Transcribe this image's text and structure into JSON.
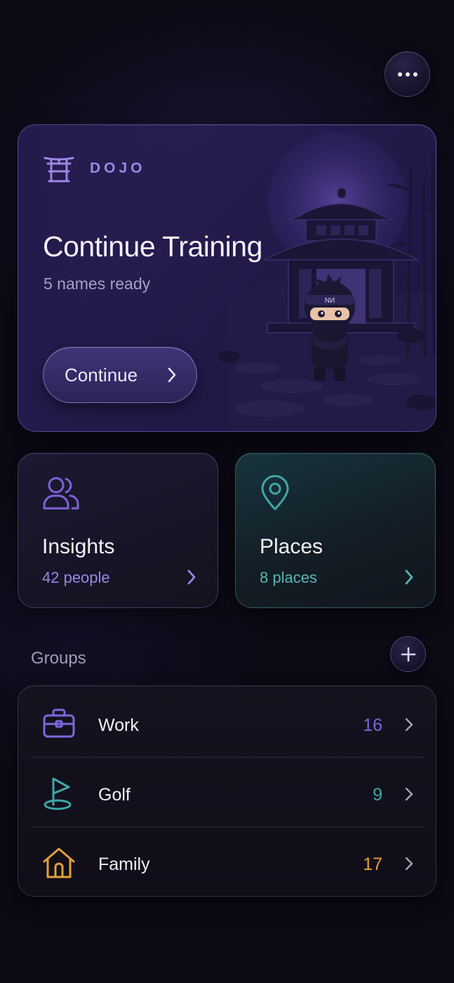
{
  "header": {
    "more_icon": "more-horizontal-icon"
  },
  "hero": {
    "brand_icon": "torii-gate-icon",
    "brand_label": "DOJO",
    "title": "Continue Training",
    "subtitle": "5 names ready",
    "button_label": "Continue",
    "illustration_badge": "NИ"
  },
  "tiles": [
    {
      "title": "Insights",
      "subtitle": "42 people",
      "icon": "people-icon",
      "accent": "#7c63d8"
    },
    {
      "title": "Places",
      "subtitle": "8 places",
      "icon": "map-pin-icon",
      "accent": "#3fa8a6"
    }
  ],
  "groups": {
    "title": "Groups",
    "add_icon": "plus-icon",
    "items": [
      {
        "name": "Work",
        "count": "16",
        "icon": "briefcase-icon",
        "color": "#7d67db"
      },
      {
        "name": "Golf",
        "count": "9",
        "icon": "golf-flag-icon",
        "color": "#3fa8a6"
      },
      {
        "name": "Family",
        "count": "17",
        "icon": "home-icon",
        "color": "#e3a137"
      }
    ]
  }
}
